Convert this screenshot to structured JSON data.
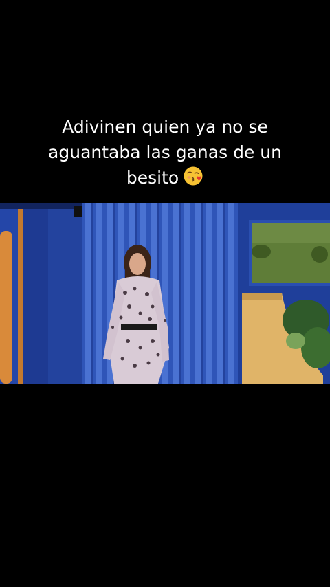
{
  "caption": {
    "lines": [
      "Adivinen quien ya no se",
      "aguantaba las ganas de un",
      "besito"
    ],
    "emoji": "face-blowing-a-kiss"
  },
  "video": {
    "scene": "video-frame",
    "colors": {
      "background": "#000000",
      "wall_blue": "#1f3f9a",
      "curtain_blue": "#3a63c4",
      "door_orange": "#d98a3a",
      "sofa_yellow": "#e0b468",
      "grass_green": "#5f7d38"
    }
  }
}
